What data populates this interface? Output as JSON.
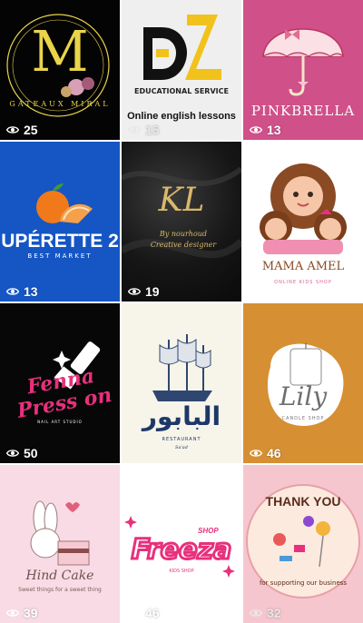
{
  "posts": [
    {
      "views": "25",
      "brand_text": "GATEAUX MIRAL",
      "monogram": "M"
    },
    {
      "views": "15",
      "monogram": "DZ",
      "brand_text": "EDUCATIONAL SERVICE",
      "caption": "Online english lessons"
    },
    {
      "views": "13",
      "brand_text": "PINKBRELLA"
    },
    {
      "views": "13",
      "brand_text": "UPÉRETTE 2",
      "tagline": "BEST MARKET"
    },
    {
      "views": "19",
      "monogram": "KL",
      "signature": "By nourhoud Creative designer"
    },
    {
      "views": "",
      "brand_text": "MAMA AMEL",
      "tagline": "ONLINE KIDS SHOP"
    },
    {
      "views": "50",
      "brand_text": "Fenna Press on",
      "tagline": "NAIL ART STUDIO"
    },
    {
      "views": "",
      "arabic_text": "البابور",
      "tagline": "RESTAURANT",
      "tagline2": "Sa'ad"
    },
    {
      "views": "46",
      "brand_text": "Lily",
      "tagline": "CANDLE SHOP"
    },
    {
      "views": "39",
      "brand_text": "Hind Cake",
      "tagline": "Sweet things for a sweet thing"
    },
    {
      "views": "46",
      "brand_text": "Freeza",
      "badge": "SHOP",
      "tagline": "KIDS SHOP"
    },
    {
      "views": "32",
      "title": "THANK YOU",
      "tagline": "for supporting our business"
    }
  ],
  "colors": {
    "gold": "#e9d44a",
    "deep_pink": "#e8307c",
    "royal_blue": "#1556c4",
    "mustard": "#d68f32"
  },
  "icons": {
    "views": "eye-icon"
  }
}
